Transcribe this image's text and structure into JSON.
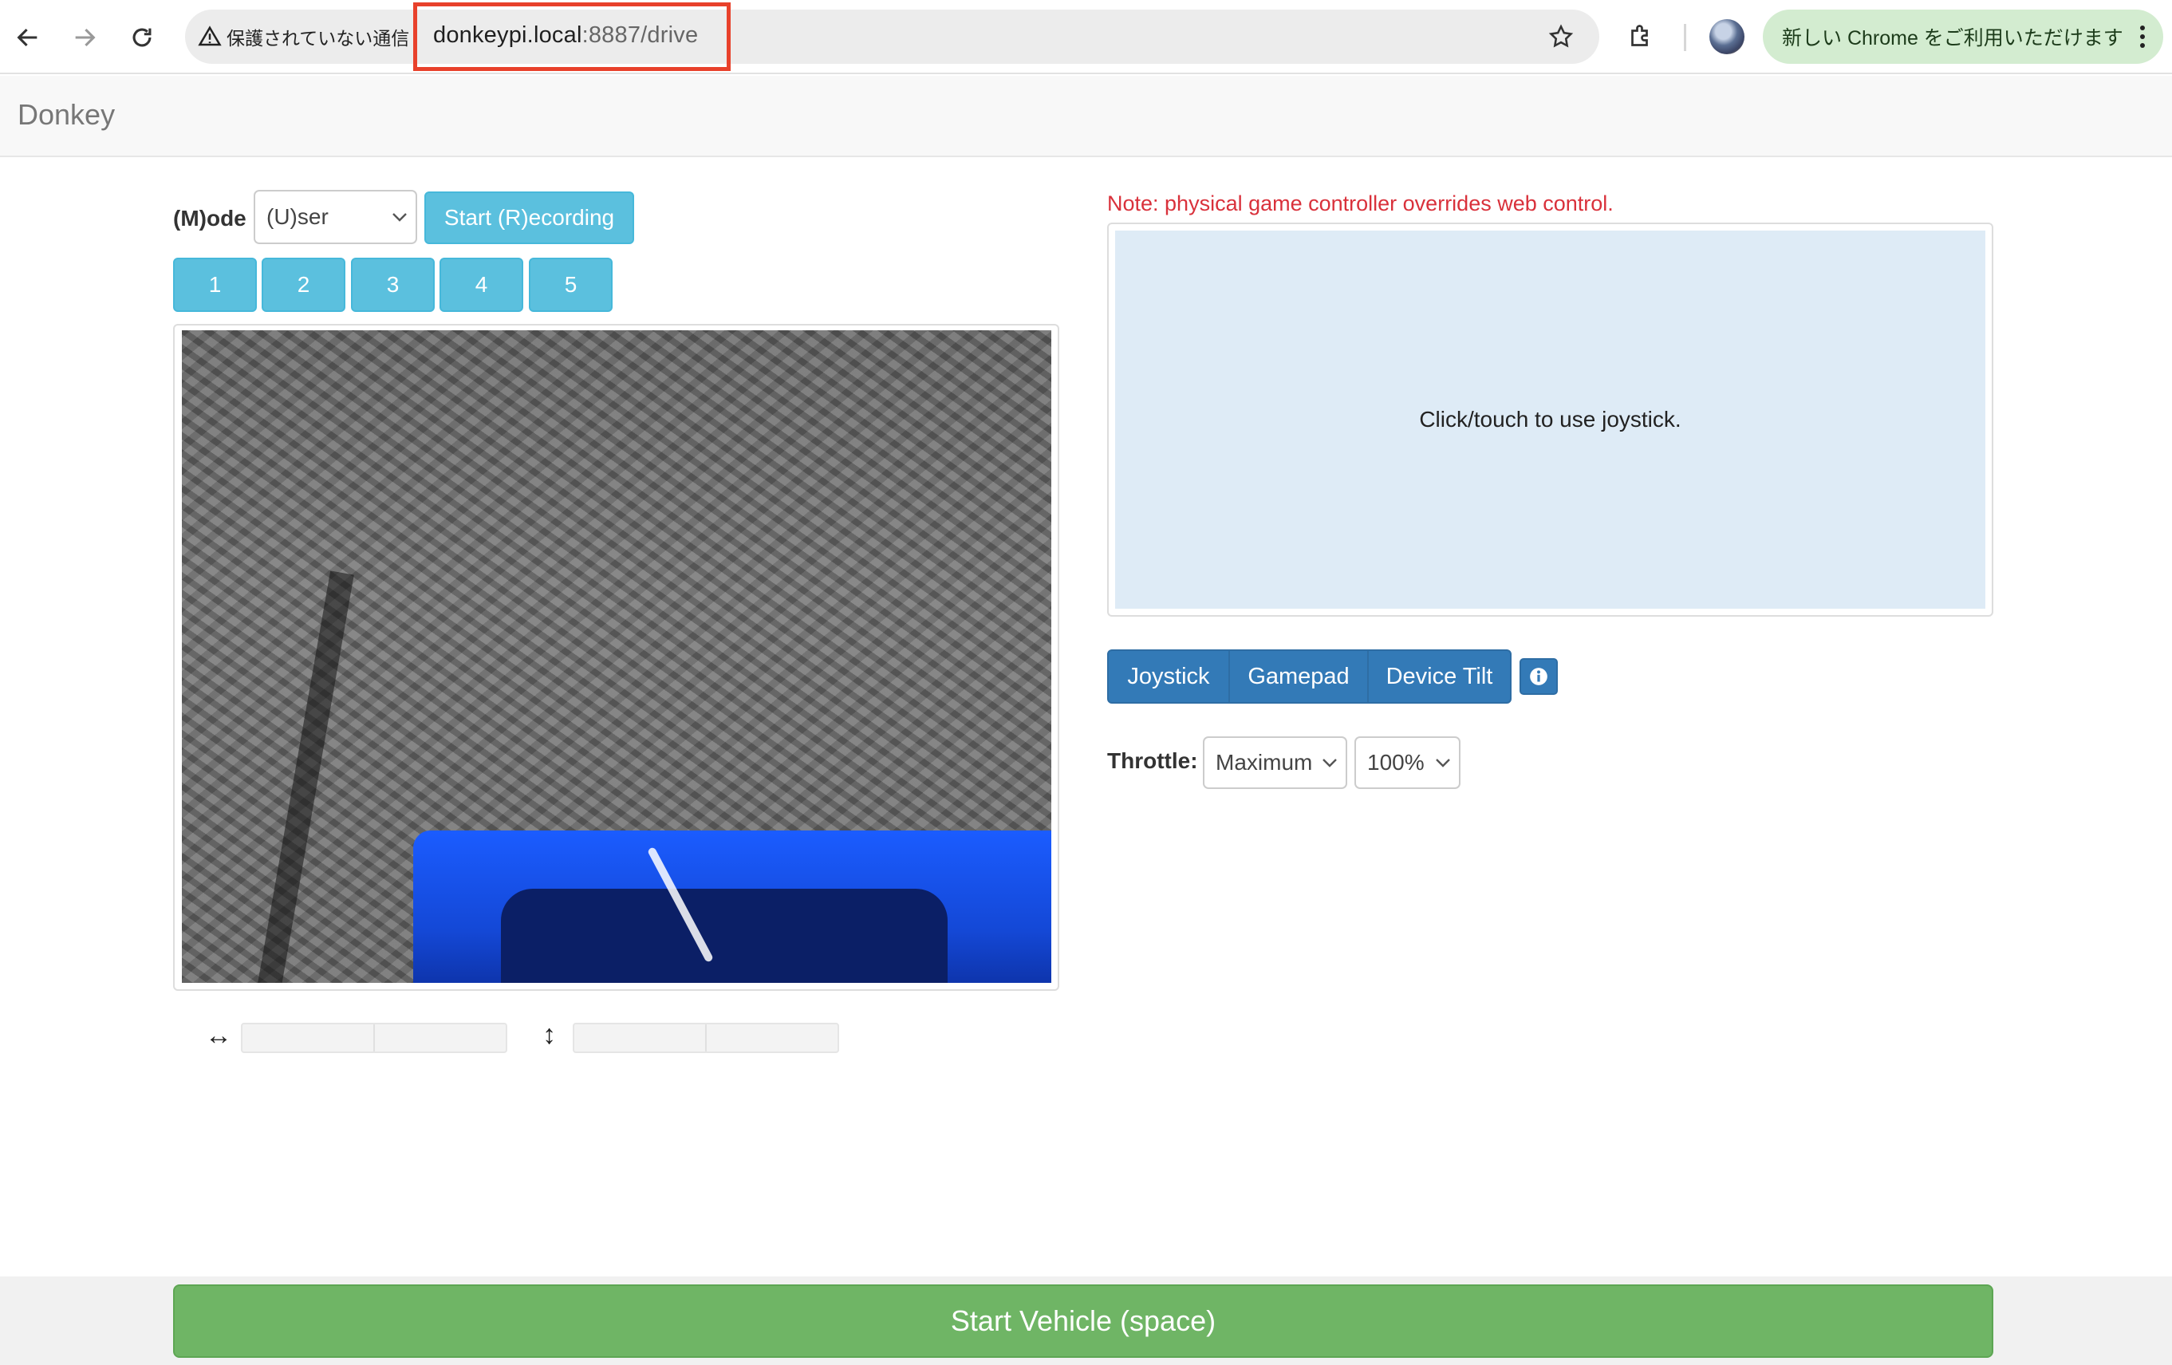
{
  "browser": {
    "security_label": "保護されていない通信",
    "url_host": "donkeypi.local",
    "url_rest": ":8887/drive",
    "update_label": "新しい Chrome をご利用いただけます"
  },
  "navbar": {
    "brand": "Donkey"
  },
  "controls": {
    "mode_label": "(M)ode",
    "mode_value": "(U)ser",
    "record_button": "Start (R)ecording",
    "presets": [
      "1",
      "2",
      "3",
      "4",
      "5"
    ]
  },
  "telemetry": {
    "horizontal_icon": "↔",
    "vertical_icon": "↕",
    "angle_values": [
      "",
      ""
    ],
    "throttle_values": [
      "",
      ""
    ]
  },
  "right_panel": {
    "note": "Note: physical game controller overrides web control.",
    "joystick_hint": "Click/touch to use joystick.",
    "control_tabs": [
      "Joystick",
      "Gamepad",
      "Device Tilt"
    ],
    "throttle_label": "Throttle:",
    "throttle_mode": "Maximum",
    "throttle_percent": "100%"
  },
  "footer": {
    "start_button": "Start Vehicle (space)"
  },
  "colors": {
    "primary": "#337ab7",
    "info": "#5bc0de",
    "success": "#6fb565",
    "danger": "#d9313b",
    "url_highlight": "#e8412b"
  }
}
